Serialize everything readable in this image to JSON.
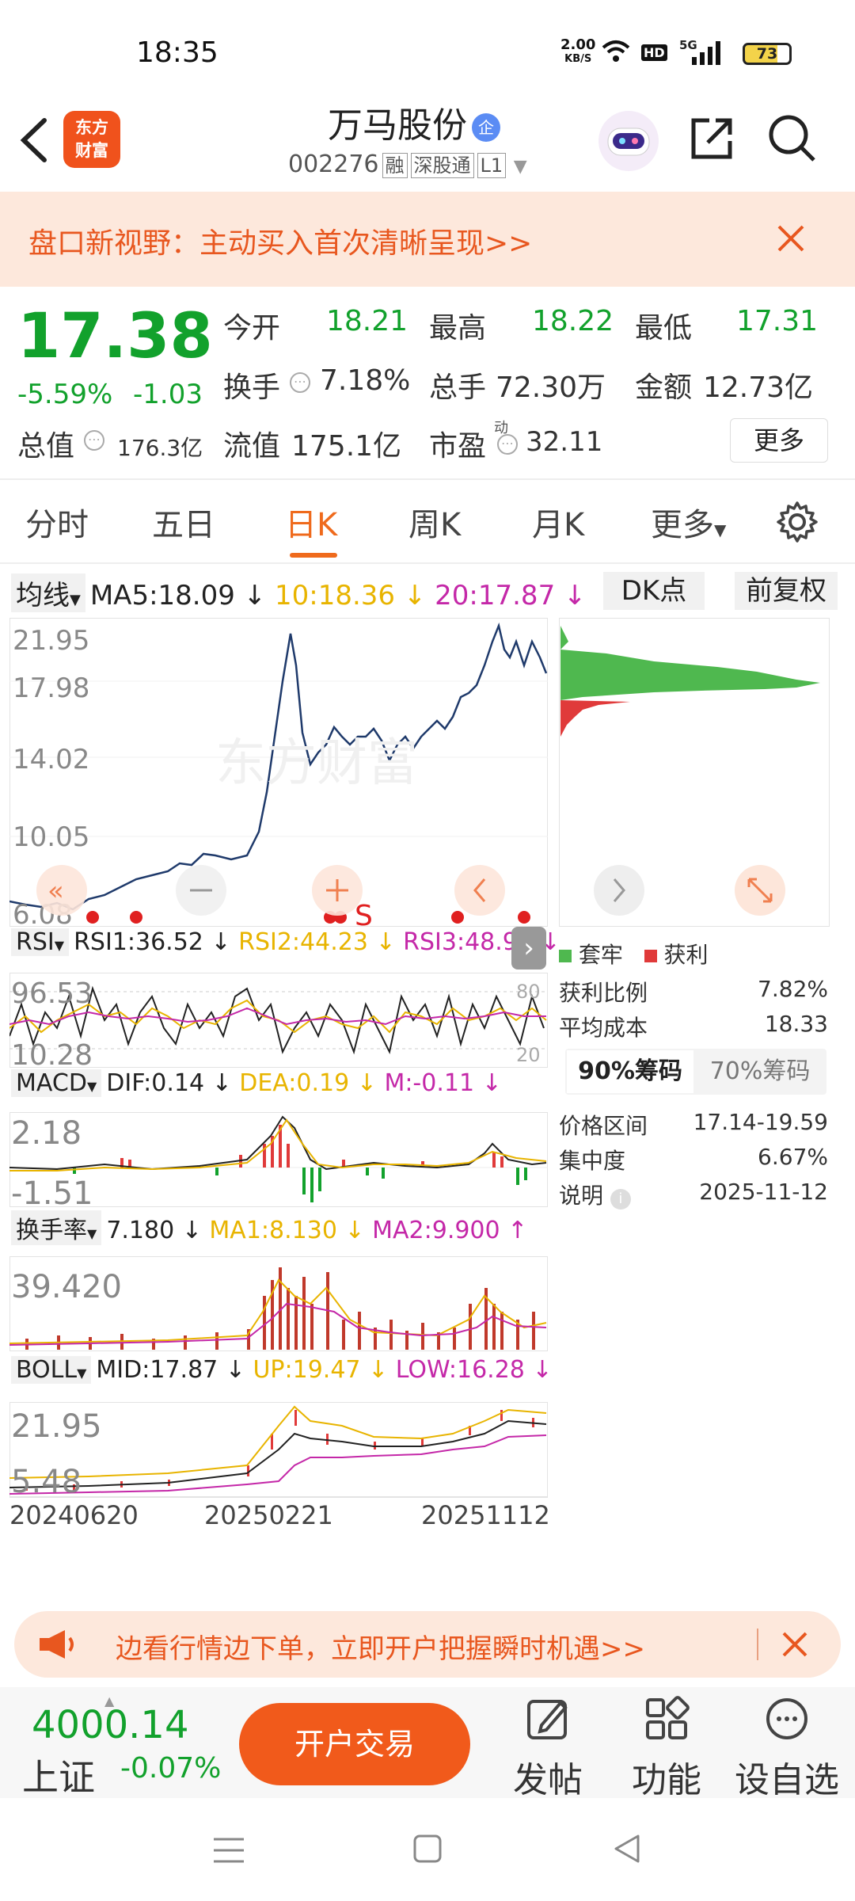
{
  "status_bar": {
    "time": "18:35",
    "net_speed": "2.00",
    "net_unit": "KB/S",
    "hd": "HD",
    "signal": "5G",
    "battery": "73"
  },
  "header": {
    "title": "万马股份",
    "qi_badge": "企",
    "code": "002276",
    "tag_rong": "融",
    "tag_sgt": "深股通",
    "tag_level": "L1",
    "logo_line1": "东方",
    "logo_line2": "财富"
  },
  "banner": {
    "text": "盘口新视野：主动买入首次清晰呈现>>"
  },
  "quote": {
    "price": "17.38",
    "change_pct": "-5.59%",
    "change": "-1.03",
    "open_label": "今开",
    "open": "18.21",
    "high_label": "最高",
    "high": "18.22",
    "low_label": "最低",
    "low": "17.31",
    "turnover_label": "换手",
    "turnover": "7.18%",
    "volume_label": "总手",
    "volume": "72.30万",
    "amount_label": "金额",
    "amount": "12.73亿",
    "mktcap_label": "总值",
    "mktcap": "176.3亿",
    "float_label": "流值",
    "float": "175.1亿",
    "pe_label": "市盈",
    "pe_sup": "动",
    "pe": "32.11",
    "more": "更多"
  },
  "tabs": [
    "分时",
    "五日",
    "日K",
    "周K",
    "月K",
    "更多"
  ],
  "kline": {
    "ma_select": "均线",
    "ma5": "MA5:18.09",
    "ma10": "10:18.36",
    "ma20": "20:17.87",
    "dk_button": "DK点",
    "fq_button": "前复权",
    "y_labels": [
      "21.95",
      "17.98",
      "14.02",
      "10.05",
      "6.08"
    ],
    "watermark": "东方财富",
    "s_mark": "S"
  },
  "chips": {
    "legend_trapped": "套牢",
    "legend_profit": "获利",
    "profit_ratio_label": "获利比例",
    "profit_ratio": "7.82%",
    "avg_cost_label": "平均成本",
    "avg_cost": "18.33",
    "tab_90": "90%筹码",
    "tab_70": "70%筹码",
    "range_label": "价格区间",
    "range": "17.14-19.59",
    "conc_label": "集中度",
    "conc": "6.67%",
    "note_label": "说明",
    "note": "2025-11-12"
  },
  "rsi": {
    "select": "RSI",
    "rsi1": "RSI1:36.52",
    "rsi2": "RSI2:44.23",
    "rsi3": "RSI3:48.98",
    "y_top": "96.53",
    "y_bot": "10.28",
    "r80": "80",
    "r20": "20"
  },
  "macd": {
    "select": "MACD",
    "dif": "DIF:0.14",
    "dea": "DEA:0.19",
    "m": "M:-0.11",
    "y_top": "2.18",
    "y_bot": "-1.51"
  },
  "turnover_ind": {
    "select": "换手率",
    "val": "7.180",
    "ma1": "MA1:8.130",
    "ma2": "MA2:9.900",
    "y_top": "39.420"
  },
  "boll": {
    "select": "BOLL",
    "mid": "MID:17.87",
    "up": "UP:19.47",
    "low": "LOW:16.28",
    "y_top": "21.95",
    "y_bot": "5.48"
  },
  "dates": [
    "20240620",
    "20250221",
    "20251112"
  ],
  "promo": {
    "text": "边看行情边下单，立即开户把握瞬时机遇>>"
  },
  "bottom": {
    "index_value": "4000.14",
    "index_name": "上证",
    "index_change": "-0.07%",
    "trade": "开户交易",
    "post": "发帖",
    "func": "功能",
    "watch": "设自选"
  },
  "colors": {
    "up": "#e03a3a",
    "down": "#12a12c",
    "accent": "#ef6a1c",
    "price_line": "#1f3a6b"
  }
}
